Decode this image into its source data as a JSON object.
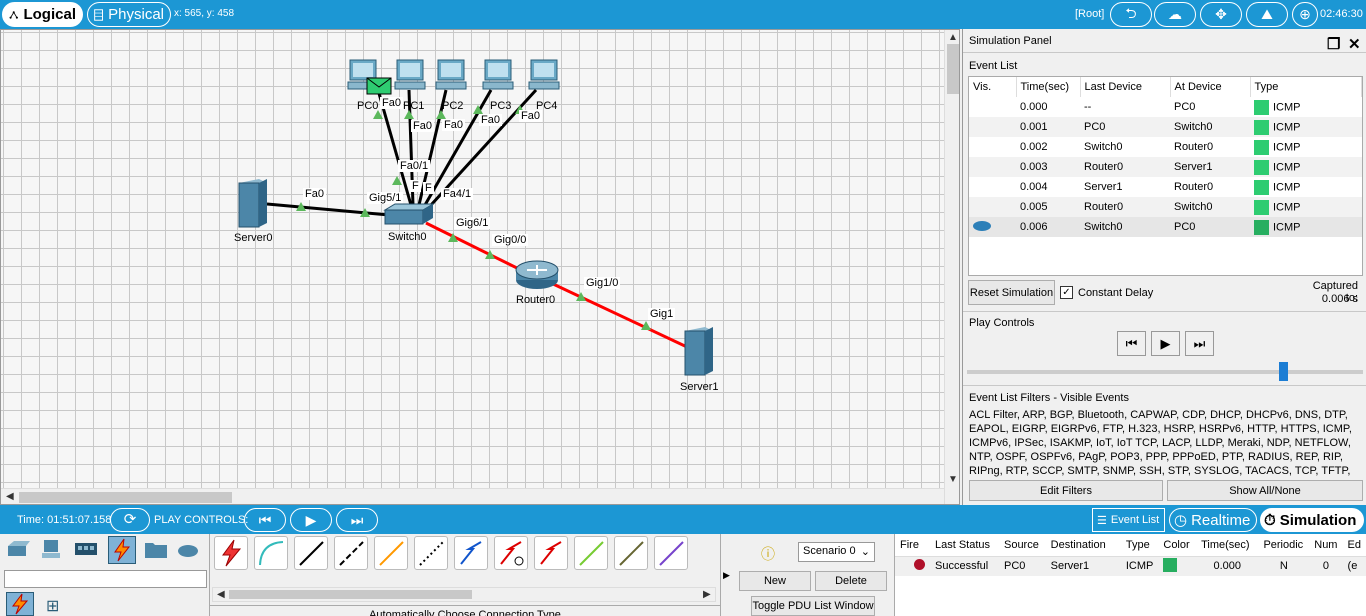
{
  "topbar": {
    "logical_label": "Logical",
    "physical_label": "Physical",
    "coords": "x: 565, y: 458",
    "root_label": "[Root]",
    "clock": "02:46:30"
  },
  "topology": {
    "devices": {
      "pc0": "PC0",
      "pc1": "PC1",
      "pc2": "PC2",
      "pc3": "PC3",
      "pc4": "PC4",
      "server0": "Server0",
      "switch0": "Switch0",
      "router0": "Router0",
      "server1": "Server1"
    },
    "ports": {
      "pc0_fa0": "Fa0",
      "pc1_fa0": "Fa0",
      "pc2_fa0": "Fa0",
      "pc3_fa0": "Fa0",
      "pc4_fa0": "Fa0",
      "sw_fa0_1": "Fa0/1",
      "sw_f2": "F",
      "sw_f3": "F",
      "sw_fa4_1": "Fa4/1",
      "server0_fa0": "Fa0",
      "sw_gig5_1": "Gig5/1",
      "sw_gig6_1": "Gig6/1",
      "rt_gig0_0": "Gig0/0",
      "rt_gig1_0": "Gig1/0",
      "server1_gig1": "Gig1"
    }
  },
  "sim_panel": {
    "title": "Simulation Panel",
    "event_list_label": "Event List",
    "columns": [
      "Vis.",
      "Time(sec)",
      "Last Device",
      "At Device",
      "Type"
    ],
    "events": [
      {
        "time": "0.000",
        "last": "--",
        "at": "PC0",
        "type": "ICMP"
      },
      {
        "time": "0.001",
        "last": "PC0",
        "at": "Switch0",
        "type": "ICMP"
      },
      {
        "time": "0.002",
        "last": "Switch0",
        "at": "Router0",
        "type": "ICMP"
      },
      {
        "time": "0.003",
        "last": "Router0",
        "at": "Server1",
        "type": "ICMP"
      },
      {
        "time": "0.004",
        "last": "Server1",
        "at": "Router0",
        "type": "ICMP"
      },
      {
        "time": "0.005",
        "last": "Router0",
        "at": "Switch0",
        "type": "ICMP"
      },
      {
        "time": "0.006",
        "last": "Switch0",
        "at": "PC0",
        "type": "ICMP"
      }
    ],
    "reset_label": "Reset Simulation",
    "constant_delay_label": "Constant Delay",
    "captured_label": "Captured to:",
    "captured_value": "0.006 s",
    "play_controls_label": "Play Controls",
    "filters_label": "Event List Filters - Visible Events",
    "filters_text": "ACL Filter, ARP, BGP, Bluetooth, CAPWAP, CDP, DHCP, DHCPv6, DNS, DTP, EAPOL, EIGRP, EIGRPv6, FTP, H.323, HSRP, HSRPv6, HTTP, HTTPS, ICMP, ICMPv6, IPSec, ISAKMP, IoT, IoT TCP, LACP, LLDP, Meraki, NDP, NETFLOW, NTP, OSPF, OSPFv6, PAgP, POP3, PPP, PPPoED, PTP, RADIUS, REP, RIP, RIPng, RTP, SCCP, SMTP, SNMP, SSH, STP, SYSLOG, TACACS, TCP, TFTP, Telnet, UDP, USB, VTP",
    "edit_filters_label": "Edit Filters",
    "show_all_label": "Show All/None"
  },
  "bottombar": {
    "time": "Time: 01:51:07.158",
    "play_controls": "PLAY CONTROLS:",
    "event_list": "Event List",
    "realtime": "Realtime",
    "simulation": "Simulation"
  },
  "connections": {
    "caption": "Automatically Choose Connection Type"
  },
  "scenario": {
    "selected": "Scenario 0",
    "new_label": "New",
    "delete_label": "Delete",
    "toggle_label": "Toggle PDU List Window"
  },
  "pdu_list": {
    "columns": [
      "Fire",
      "Last Status",
      "Source",
      "Destination",
      "Type",
      "Color",
      "Time(sec)",
      "Periodic",
      "Num",
      "Ed"
    ],
    "rows": [
      {
        "last_status": "Successful",
        "source": "PC0",
        "destination": "Server1",
        "type": "ICMP",
        "time": "0.000",
        "periodic": "N",
        "num": "0",
        "edit": "(e"
      }
    ]
  },
  "colors": {
    "accent": "#1c97d4",
    "icmp": "#2ecc71",
    "link_red": "#ff0000",
    "link_black": "#000000",
    "port_up": "#5cb85c"
  }
}
